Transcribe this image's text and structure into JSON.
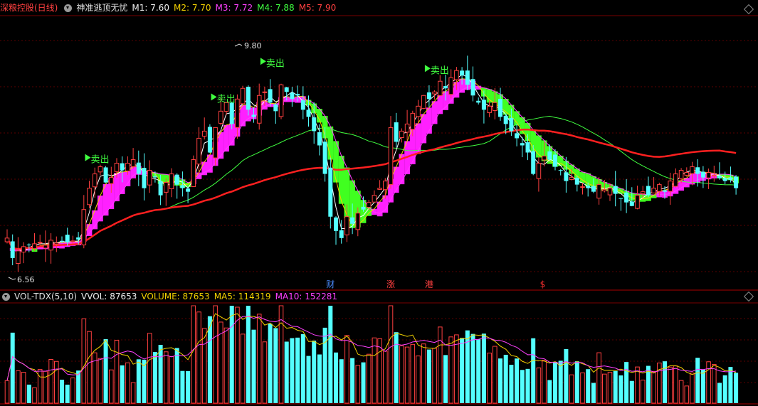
{
  "header": {
    "stock_name": "深粮控股(日线)",
    "indicator_name": "神准逃顶无忧",
    "m1_label": "M1: 7.60",
    "m2_label": "M2: 7.70",
    "m3_label": "M3: 7.72",
    "m4_label": "M4: 7.88",
    "m5_label": "M5: 7.90"
  },
  "vol_header": {
    "name": "VOL-TDX(5,10)",
    "vvol_label": "VVOL: 87653",
    "volume_label": "VOLUME: 87653",
    "ma5_label": "MA5: 114319",
    "ma10_label": "MA10: 152281"
  },
  "chart_data": {
    "type": "candlestick",
    "high_label": "9.80",
    "low_label": "6.56",
    "y_range": [
      6.3,
      10.1
    ],
    "sell_label": "卖出",
    "sell_indices": [
      15,
      38,
      47,
      77
    ],
    "markers": [
      {
        "text": "财",
        "index": 59,
        "color": "#4a8cff"
      },
      {
        "text": "涨",
        "index": 70,
        "color": "#ff4040"
      },
      {
        "text": "港",
        "index": 77,
        "color": "#ff4040"
      },
      {
        "text": "$",
        "index": 98,
        "color": "#ff3030"
      }
    ],
    "candles_close": [
      7.0,
      6.72,
      6.82,
      6.88,
      6.9,
      6.92,
      6.94,
      6.9,
      6.97,
      6.93,
      6.96,
      6.94,
      6.96,
      6.98,
      7.4,
      7.7,
      7.9,
      8.0,
      7.78,
      7.85,
      8.05,
      7.95,
      8.05,
      8.1,
      7.9,
      7.7,
      7.95,
      7.85,
      7.6,
      7.78,
      7.9,
      7.75,
      7.7,
      7.65,
      8.1,
      8.4,
      8.5,
      8.2,
      8.55,
      8.78,
      8.9,
      8.6,
      8.95,
      9.1,
      8.8,
      8.7,
      9.0,
      9.05,
      8.9,
      8.78,
      9.15,
      9.05,
      8.95,
      9.0,
      8.8,
      8.7,
      8.5,
      8.3,
      7.9,
      7.3,
      7.1,
      7.0,
      7.3,
      7.2,
      7.35,
      7.4,
      7.5,
      7.6,
      7.7,
      7.8,
      8.55,
      8.35,
      8.5,
      8.6,
      8.75,
      8.85,
      9.0,
      8.95,
      9.05,
      9.2,
      9.1,
      9.25,
      9.35,
      9.28,
      9.15,
      9.0,
      8.9,
      8.8,
      8.85,
      8.9,
      8.7,
      8.6,
      8.5,
      8.4,
      8.3,
      8.2,
      7.9,
      8.05,
      8.15,
      8.1,
      8.0,
      7.95,
      7.8,
      7.85,
      7.75,
      7.72,
      7.7,
      7.65,
      7.75,
      7.68,
      7.7,
      7.62,
      7.55,
      7.5,
      7.45,
      7.6,
      7.65,
      7.6,
      7.7,
      7.75,
      7.65,
      7.8,
      7.9,
      7.95,
      7.92,
      8.0,
      7.9,
      7.85,
      7.92,
      7.88,
      7.84,
      7.8,
      7.82,
      7.7
    ]
  }
}
